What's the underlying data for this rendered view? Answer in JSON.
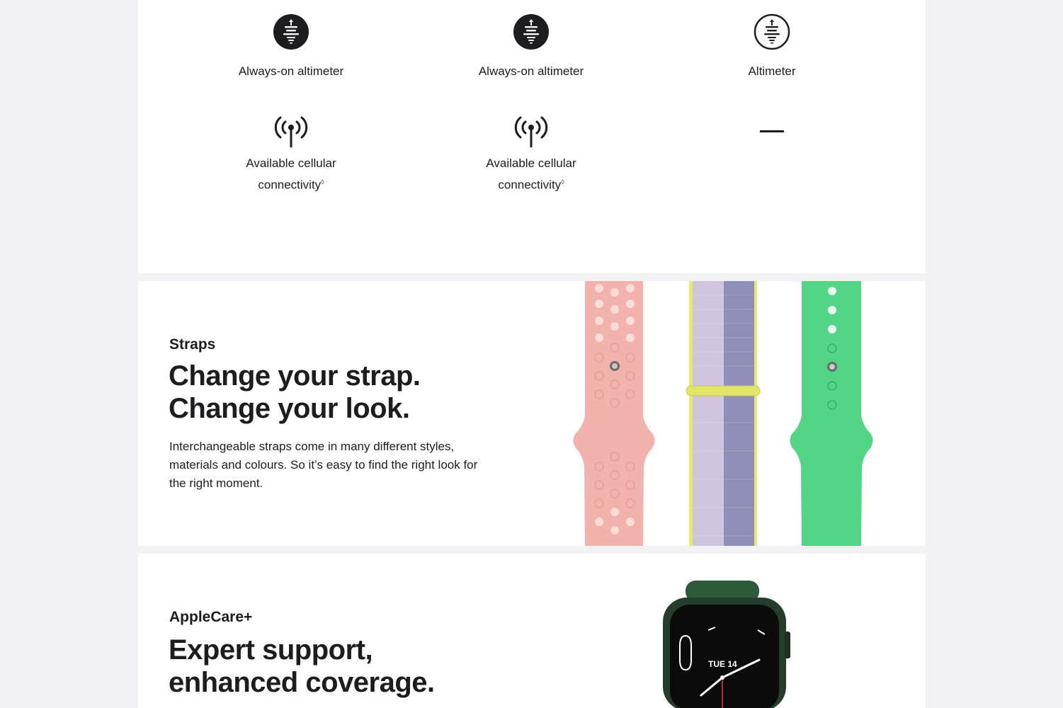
{
  "compare": {
    "row1": [
      {
        "label": "Always-on altimeter",
        "icon": "altimeter-icon"
      },
      {
        "label": "Always-on altimeter",
        "icon": "altimeter-icon"
      },
      {
        "label": "Altimeter",
        "icon": "altimeter-outline-icon"
      }
    ],
    "row2": [
      {
        "line1": "Available cellular",
        "line2": "connectivity",
        "footnote": "◊",
        "icon": "cellular-antenna-icon"
      },
      {
        "line1": "Available cellular",
        "line2": "connectivity",
        "footnote": "◊",
        "icon": "cellular-antenna-icon"
      },
      {
        "dash": "—"
      }
    ]
  },
  "straps": {
    "eyebrow": "Straps",
    "headline_line1": "Change your strap.",
    "headline_line2": "Change your look.",
    "body": "Interchangeable straps come in many different styles, materials and colours. So it’s easy to find the right look for the right moment.",
    "colors": {
      "sport_pink": "#f2b3ad",
      "loop_lilac": "#cfc6dd",
      "loop_lavender": "#8d8fb8",
      "loop_yellow": "#e9ea6a",
      "sport_green": "#52d585"
    }
  },
  "applecare": {
    "eyebrow": "AppleCare+",
    "headline_line1": "Expert support,",
    "headline_line2": "enhanced coverage.",
    "watch_date": "TUE 14",
    "colors": {
      "case_green": "#243d2c",
      "band_green": "#2c5a3b"
    }
  }
}
